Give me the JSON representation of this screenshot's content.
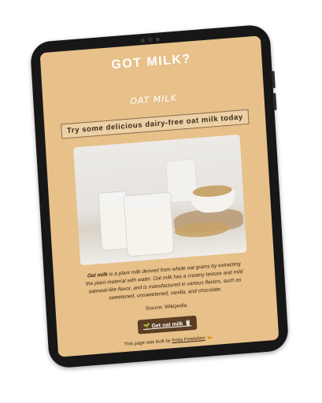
{
  "page": {
    "title": "GOT MILK?",
    "logo_text": "OAT MILK",
    "tagline": "Try some delicious dairy-free oat milk today",
    "photo_alt": "Glasses of oat milk with oats",
    "description_bold": "Oat milk",
    "description_rest": " is a plant milk derived from whole oat grains by extracting the plant material with water. Oat milk has a creamy texture and mild oatmeal-like flavor, and is manufactured in various flavors, such as sweetened, unsweetened, vanilla, and chocolate.",
    "source_label": "Source:",
    "source_link": "Wikipedia",
    "cta_icon": "🌱",
    "cta_label": "Get oat milk",
    "cta_icon2": "🥛",
    "footer_prefix": "This page was built by",
    "footer_author": "Frida Freeleben",
    "footer_emoji": "🐆"
  },
  "colors": {
    "screen_bg": "#e7c08a",
    "cta_bg": "#5a3d22",
    "device": "#171717"
  }
}
